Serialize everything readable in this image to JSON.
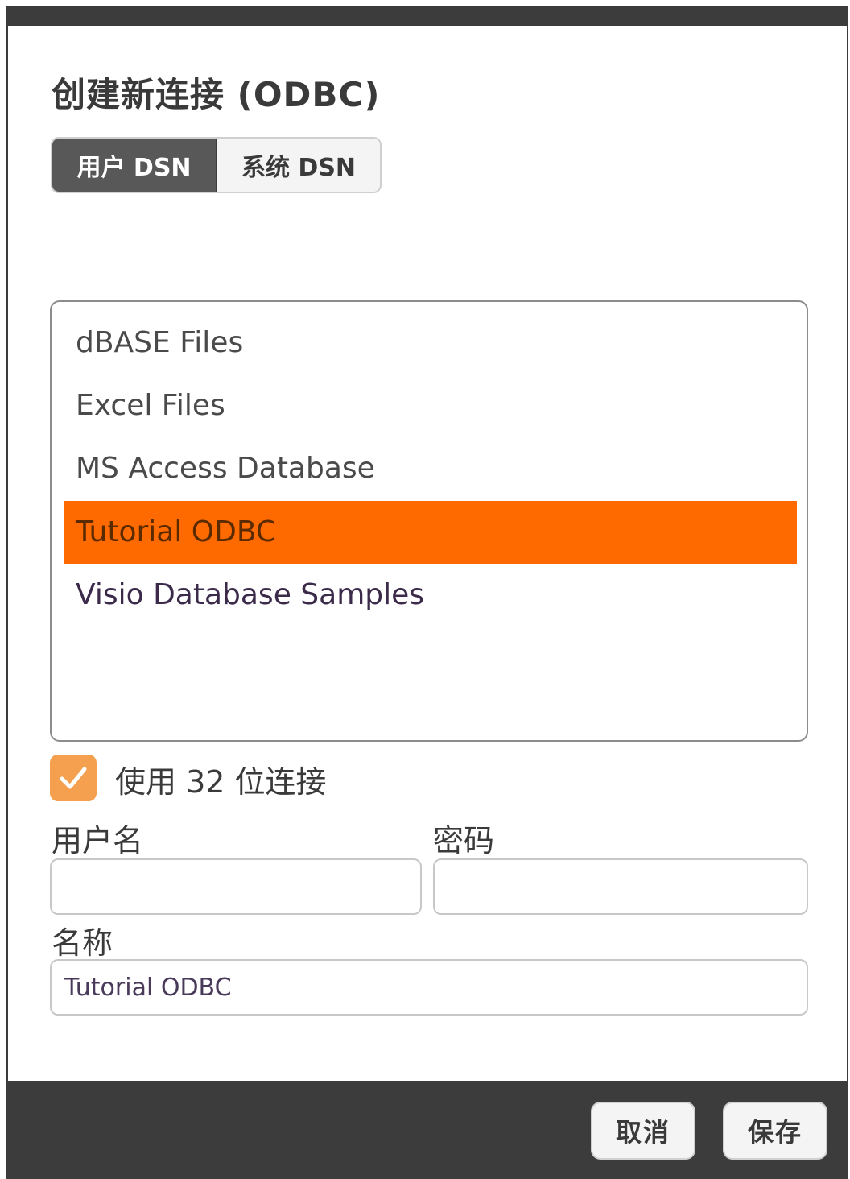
{
  "dialog": {
    "title": "创建新连接 (ODBC)"
  },
  "dsn_tabs": [
    {
      "label": "用户 DSN",
      "active": true
    },
    {
      "label": "系统 DSN",
      "active": false
    }
  ],
  "dsn_list": {
    "items": [
      {
        "label": "dBASE Files",
        "selected": false
      },
      {
        "label": "Excel Files",
        "selected": false
      },
      {
        "label": "MS Access Database",
        "selected": false
      },
      {
        "label": "Tutorial ODBC",
        "selected": true
      },
      {
        "label": "Visio Database Samples",
        "selected": false
      }
    ],
    "selected_color": "#ff6a00"
  },
  "use_32bit": {
    "label": "使用 32 位连接",
    "checked": true,
    "color": "#f5a04e"
  },
  "fields": {
    "username_label": "用户名",
    "username_value": "",
    "password_label": "密码",
    "password_value": "",
    "name_label": "名称",
    "name_value": "Tutorial ODBC"
  },
  "footer": {
    "cancel_label": "取消",
    "save_label": "保存"
  },
  "colors": {
    "dark_bar": "#3c3c3c",
    "accent": "#ff6a00"
  }
}
